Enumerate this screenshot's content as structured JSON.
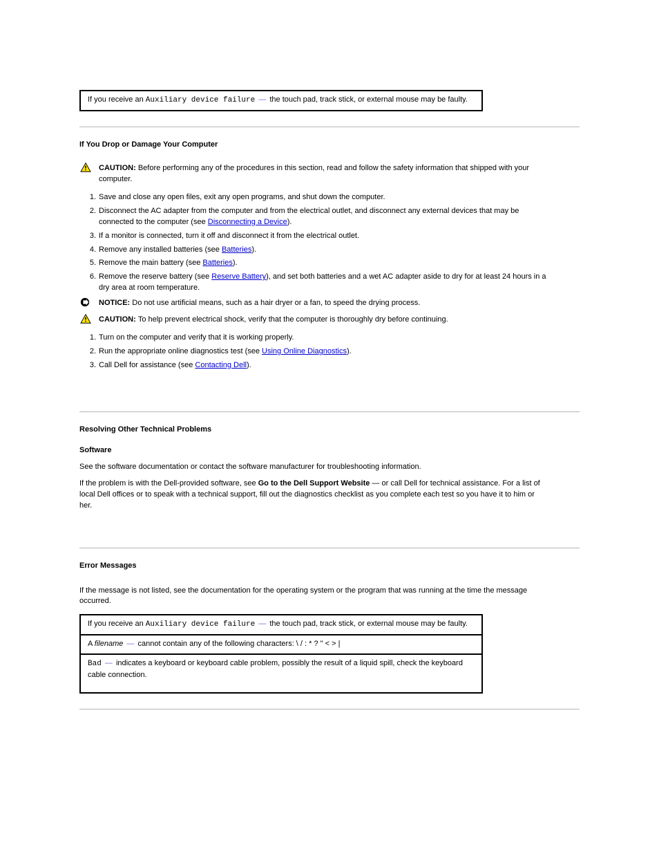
{
  "top_box": {
    "row": {
      "pre": "If you receive an ",
      "code": "Auxiliary device failure",
      "dash": " — ",
      "post": "the touch pad, track stick, or external mouse may be faulty."
    }
  },
  "sec1": {
    "title": "If You Drop or Damage Your Computer",
    "caution_label": "CAUTION: ",
    "caution_text": "Before performing any of the procedures in this section, read and follow the safety information that shipped with your computer.",
    "steps": [
      {
        "text": "Save and close any open files, exit any open programs, and shut down the computer."
      },
      {
        "pre": "Disconnect the AC adapter from the computer and from the electrical outlet, and disconnect any external devices that may be connected to the computer (see ",
        "link": "Disconnecting a Device",
        "post": ")."
      },
      {
        "text": "If a monitor is connected, turn it off and disconnect it from the electrical outlet."
      },
      {
        "pre": "Remove any installed batteries (see ",
        "link": "Batteries",
        "post": ")."
      },
      {
        "pre": "Remove the main battery (see ",
        "link": "Batteries",
        "post": ")."
      },
      {
        "pre": "Remove the reserve battery (see ",
        "link": "Reserve Battery",
        "post": "), and set both batteries and a wet AC adapter aside to dry for at least 24 hours in a dry area at room temperature."
      }
    ],
    "notice_label": "NOTICE: ",
    "notice_text": "Do not use artificial means, such as a hair dryer or a fan, to speed the drying process.",
    "caution2_label": "CAUTION: ",
    "caution2_text": "To help prevent electrical shock, verify that the computer is thoroughly dry before continuing.",
    "steps2": [
      {
        "text": "Turn on the computer and verify that it is working properly."
      },
      {
        "pre": "Run the appropriate online diagnostics test (see ",
        "link": "Using Online Diagnostics",
        "post": ")."
      },
      {
        "pre": "Call Dell for assistance (see ",
        "link": "Contacting Dell",
        "post": ")."
      }
    ]
  },
  "sec2": {
    "title": "Resolving Other Technical Problems",
    "para1": "See the software documentation or contact the software manufacturer for troubleshooting information.",
    "para2_pre": "If the problem is with the Dell-provided software, see ",
    "para2_bold": "Go to the Dell Support Website",
    "para2_post": " — or call Dell for technical assistance. For a list of local Dell offices or to speak with a technical support, fill out the diagnostics checklist as you complete each test so you have it to him or her."
  },
  "sec3": {
    "title": "Error Messages",
    "intro": "If the message is not listed, see the documentation for the operating system or the program that was running at the time the message occurred.",
    "rows": [
      {
        "pre": "If you receive an ",
        "code": "Auxiliary device failure",
        "dash": " — ",
        "post": "the touch pad, track stick, or external mouse may be faulty."
      },
      {
        "pre": "A ",
        "code": "filename",
        "dash": " — ",
        "post": "cannot contain any of the following characters: \\ / : * ? \" < > |"
      },
      {
        "code": "Bad",
        "dash": " — ",
        "post": "indicates a keyboard or keyboard cable problem, possibly the result of a liquid spill, check the keyboard cable connection."
      }
    ]
  }
}
